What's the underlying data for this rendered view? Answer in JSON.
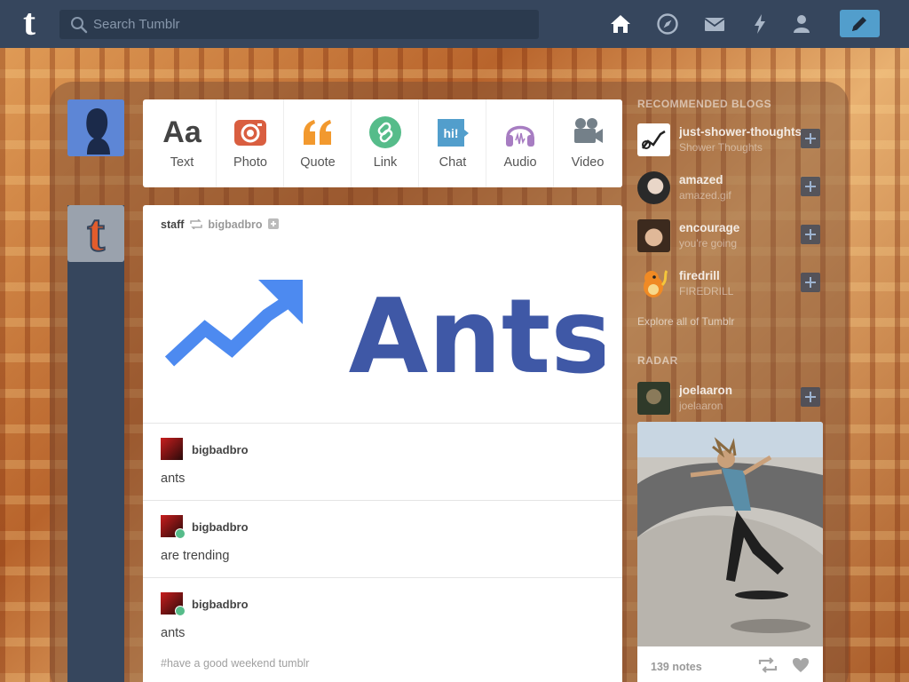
{
  "nav": {
    "logo": "t",
    "search_placeholder": "Search Tumblr",
    "icons": [
      "home-icon",
      "explore-icon",
      "inbox-icon",
      "activity-icon",
      "account-icon"
    ],
    "compose_icon": "pencil-icon"
  },
  "composer": {
    "types": [
      {
        "label": "Text",
        "icon": "text-icon",
        "color": "#444444"
      },
      {
        "label": "Photo",
        "icon": "camera-icon",
        "color": "#d95e40"
      },
      {
        "label": "Quote",
        "icon": "quote-icon",
        "color": "#f2992e"
      },
      {
        "label": "Link",
        "icon": "link-icon",
        "color": "#56bc8a"
      },
      {
        "label": "Chat",
        "icon": "chat-icon",
        "color": "#529ecc"
      },
      {
        "label": "Audio",
        "icon": "headphones-icon",
        "color": "#a77dc2"
      },
      {
        "label": "Video",
        "icon": "video-camera-icon",
        "color": "#748089"
      }
    ]
  },
  "post": {
    "author": "staff",
    "reblogged_from": "bigbadbro",
    "image_text": "Ants",
    "replies": [
      {
        "user": "bigbadbro",
        "text": "ants",
        "reblog": false
      },
      {
        "user": "bigbadbro",
        "text": "are trending",
        "reblog": true
      },
      {
        "user": "bigbadbro",
        "text": "ants",
        "reblog": true
      }
    ],
    "tags": "#have a good weekend tumblr"
  },
  "sidebar": {
    "recommended_heading": "RECOMMENDED BLOGS",
    "recommended": [
      {
        "name": "just-shower-thoughts",
        "subtitle": "Shower Thoughts"
      },
      {
        "name": "amazed",
        "subtitle": "amazed.gif"
      },
      {
        "name": "encourage",
        "subtitle": "you're going"
      },
      {
        "name": "firedrill",
        "subtitle": "FIREDRILL"
      }
    ],
    "explore_link": "Explore all of Tumblr",
    "radar_heading": "RADAR",
    "radar_blog": {
      "name": "joelaaron",
      "subtitle": "joelaaron"
    },
    "radar_notes": "139 notes"
  },
  "colors": {
    "nav_bg": "#36465d",
    "accent": "#529ecc"
  }
}
